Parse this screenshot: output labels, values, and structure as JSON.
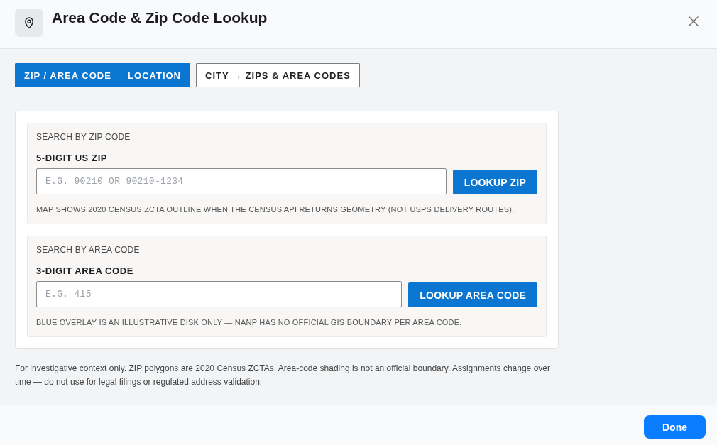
{
  "dialog": {
    "title": "Area Code & Zip Code Lookup"
  },
  "tabs": [
    {
      "label": "ZIP / AREA CODE → LOCATION",
      "selected": true
    },
    {
      "label": "CITY → ZIPS & AREA CODES",
      "selected": false
    }
  ],
  "sections": [
    {
      "heading": "SEARCH BY ZIP CODE",
      "field_label": "5-DIGIT US ZIP",
      "placeholder": "E.G. 90210 OR 90210-1234",
      "button": "LOOKUP ZIP",
      "hint": "MAP SHOWS 2020 CENSUS ZCTA OUTLINE WHEN THE CENSUS API RETURNS GEOMETRY (NOT USPS DELIVERY ROUTES)."
    },
    {
      "heading": "SEARCH BY AREA CODE",
      "field_label": "3-DIGIT AREA CODE",
      "placeholder": "E.G. 415",
      "button": "LOOKUP AREA CODE",
      "hint": "BLUE OVERLAY IS AN ILLUSTRATIVE DISK ONLY — NANP HAS NO OFFICIAL GIS BOUNDARY PER AREA CODE."
    }
  ],
  "disclaimer": "For investigative context only. ZIP polygons are 2020 Census ZCTAs. Area-code shading is not an official boundary. Assignments change over time — do not use for legal filings or regulated address validation.",
  "footer": {
    "button": "Done"
  }
}
